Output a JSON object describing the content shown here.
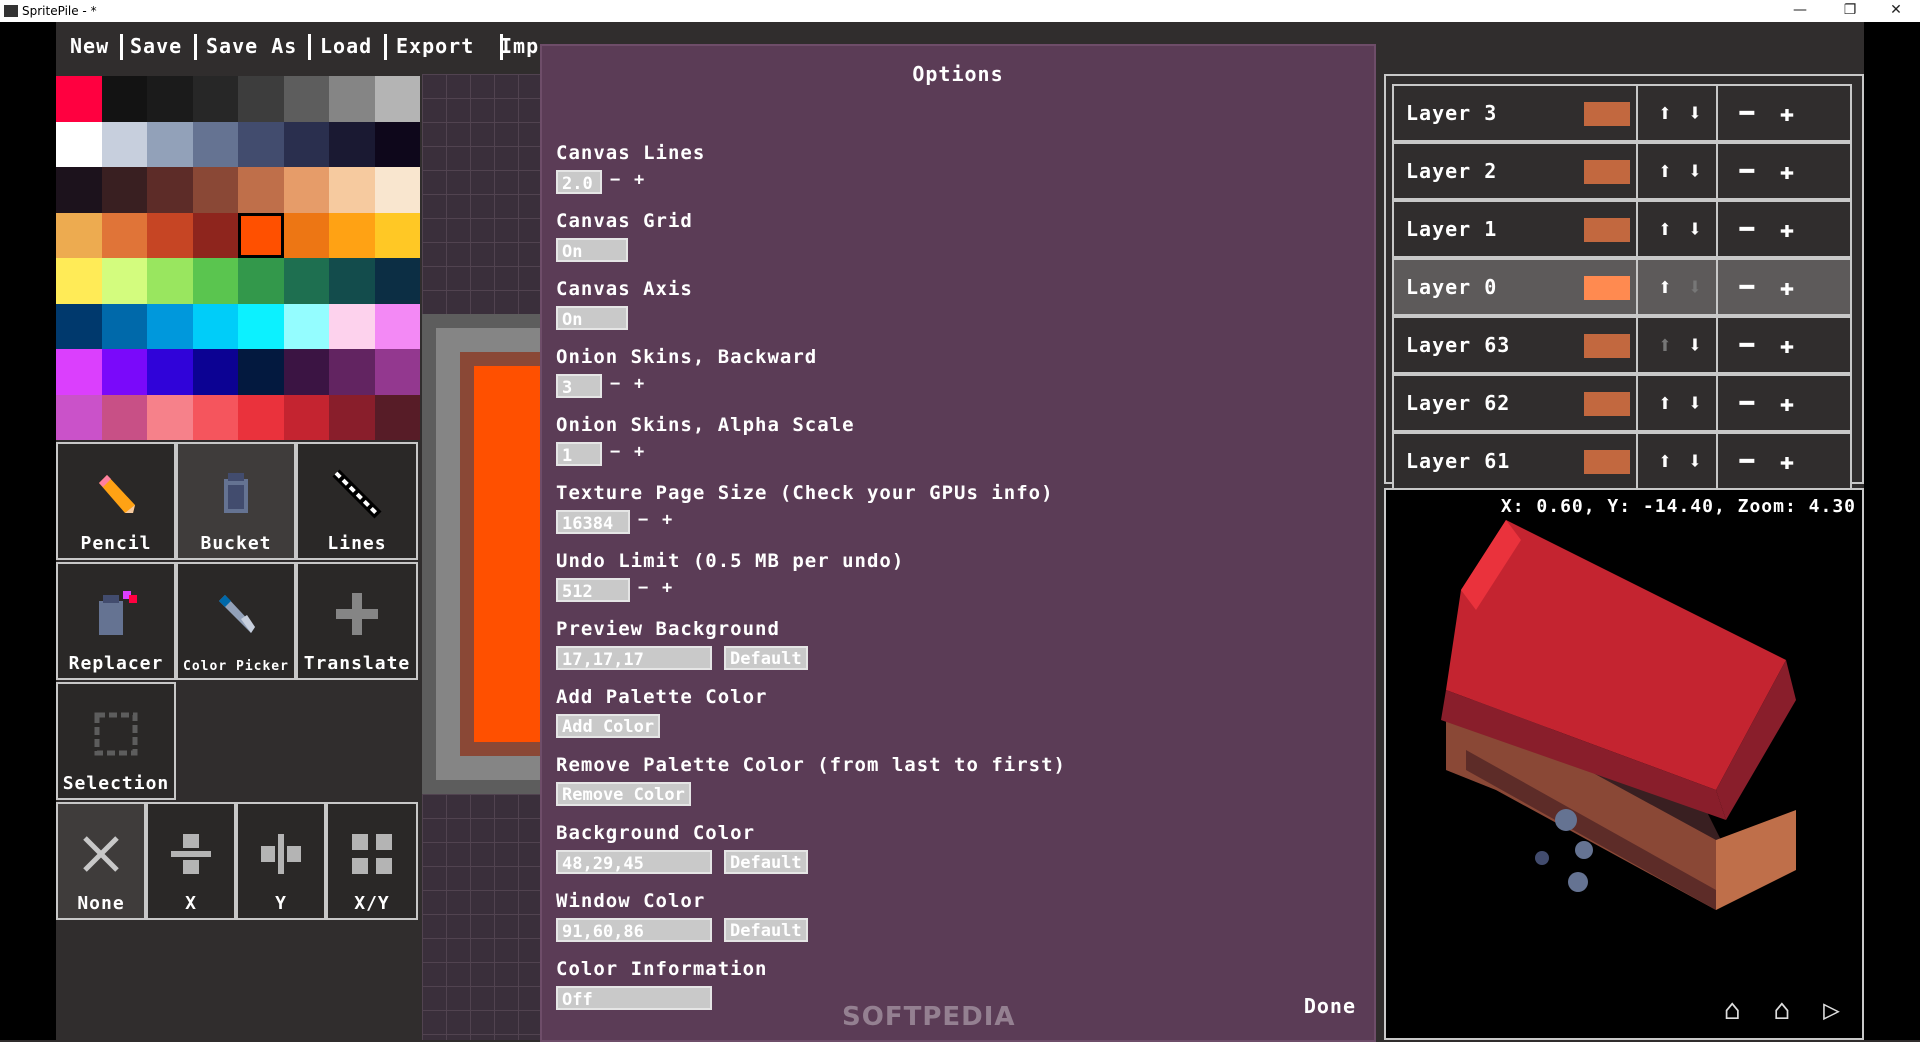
{
  "window": {
    "title": "SpritePile - *",
    "minimize": "—",
    "maximize": "❐",
    "close": "✕"
  },
  "menu": [
    "New",
    "Save",
    "Save As",
    "Load",
    "Export",
    "Imp"
  ],
  "palette": [
    "#ff0040",
    "#131313",
    "#1b1b1b",
    "#272727",
    "#3d3d3d",
    "#5d5d5d",
    "#858585",
    "#b4b4b4",
    "#ffffff",
    "#c7cfdd",
    "#92a1b9",
    "#657392",
    "#424c6e",
    "#2a2f4e",
    "#1a1932",
    "#0e071b",
    "#1c121c",
    "#391f21",
    "#5d2c28",
    "#8a4836",
    "#bf6f4a",
    "#e69c69",
    "#f6ca9f",
    "#f9e6cf",
    "#edab50",
    "#e07438",
    "#c64524",
    "#8e251d",
    "#ff5000",
    "#ed7614",
    "#ffa214",
    "#ffc825",
    "#ffeb57",
    "#d3fc7e",
    "#99e65f",
    "#5ac54f",
    "#33984b",
    "#1e6f50",
    "#134c4c",
    "#0c2e44",
    "#00396d",
    "#0069aa",
    "#0098dc",
    "#00cdf9",
    "#0cf1ff",
    "#94fdff",
    "#fdd2ed",
    "#f389f5",
    "#db3ffd",
    "#7a09fa",
    "#3003d9",
    "#0c0293",
    "#03193f",
    "#3b1443",
    "#622461",
    "#93388f",
    "#ca52c9",
    "#c85086",
    "#f6818a",
    "#f5555d",
    "#ea323c",
    "#c42430",
    "#891e2b",
    "#571c27"
  ],
  "selected_swatch": 28,
  "tools": {
    "pencil": "Pencil",
    "bucket": "Bucket",
    "lines": "Lines",
    "replacer": "Replacer",
    "color_picker": "Color Picker",
    "translate": "Translate",
    "selection": "Selection",
    "mirror_none": "None",
    "mirror_x": "X",
    "mirror_y": "Y",
    "mirror_xy": "X/Y"
  },
  "options": {
    "title": "Options",
    "canvas_lines": {
      "label": "Canvas Lines",
      "value": "2.0"
    },
    "canvas_grid": {
      "label": "Canvas Grid",
      "value": "On"
    },
    "canvas_axis": {
      "label": "Canvas Axis",
      "value": "On"
    },
    "onion_backward": {
      "label": "Onion Skins, Backward",
      "value": "3"
    },
    "onion_alpha": {
      "label": "Onion Skins, Alpha Scale",
      "value": "1"
    },
    "texture_page": {
      "label": "Texture Page Size (Check your GPUs info)",
      "value": "16384"
    },
    "undo_limit": {
      "label": "Undo Limit (0.5 MB per undo)",
      "value": "512"
    },
    "preview_bg": {
      "label": "Preview Background",
      "value": "17,17,17",
      "default": "Default"
    },
    "add_palette": {
      "label": "Add Palette Color",
      "button": "Add Color"
    },
    "remove_palette": {
      "label": "Remove Palette Color (from last to first)",
      "button": "Remove Color"
    },
    "background_color": {
      "label": "Background Color",
      "value": "48,29,45",
      "default": "Default"
    },
    "window_color": {
      "label": "Window Color",
      "value": "91,60,86",
      "default": "Default"
    },
    "color_info": {
      "label": "Color Information",
      "value": "Off"
    },
    "minus": "−",
    "plus": "+",
    "done": "Done"
  },
  "layers": [
    {
      "name": "Layer 3",
      "active": false
    },
    {
      "name": "Layer 2",
      "active": false
    },
    {
      "name": "Layer 1",
      "active": false
    },
    {
      "name": "Layer 0",
      "active": true
    },
    {
      "name": "Layer 63",
      "active": false
    },
    {
      "name": "Layer 62",
      "active": false
    },
    {
      "name": "Layer 61",
      "active": false
    }
  ],
  "preview": {
    "coords": "X: 0.60, Y: -14.40, Zoom: 4.30",
    "controls": "⌂ ⌂ ▷"
  },
  "watermark": "SOFTPEDIA"
}
